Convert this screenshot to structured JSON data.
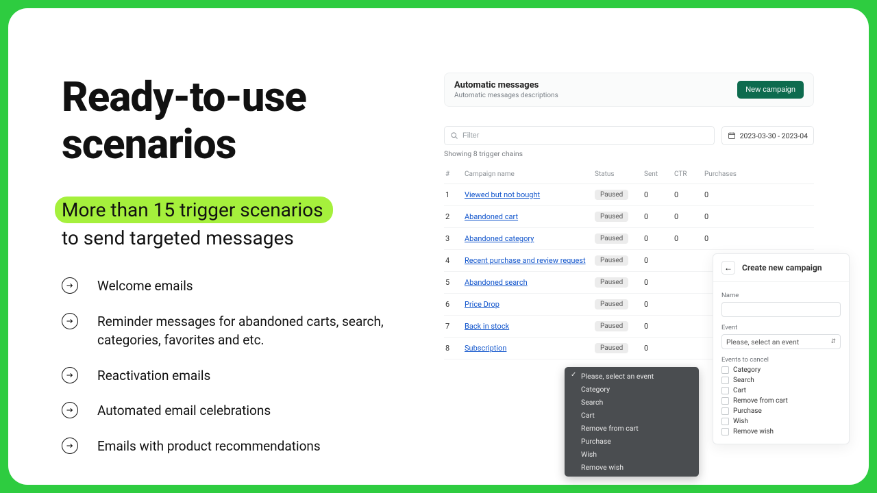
{
  "left": {
    "headline_l1": "Ready-to-use",
    "headline_l2": "scenarios",
    "sub_hl": "More than 15 trigger scenarios",
    "sub_rest": "to send targeted messages",
    "features": [
      "Welcome emails",
      "Reminder messages for abandoned carts, search, categories, favorites and etc.",
      "Reactivation emails",
      "Automated email celebrations",
      "Emails with product recommendations"
    ]
  },
  "app": {
    "title": "Automatic messages",
    "subtitle": "Automatic messages descriptions",
    "new_campaign": "New campaign",
    "filter_placeholder": "Filter",
    "date_range": "2023-03-30 - 2023-04",
    "showing": "Showing 8 trigger chains",
    "columns": {
      "n": "#",
      "name": "Campaign name",
      "status": "Status",
      "sent": "Sent",
      "ctr": "CTR",
      "purch": "Purchases"
    },
    "rows": [
      {
        "n": "1",
        "name": "Viewed but not bought",
        "status": "Paused",
        "sent": "0",
        "ctr": "0",
        "purch": "0"
      },
      {
        "n": "2",
        "name": "Abandoned cart",
        "status": "Paused",
        "sent": "0",
        "ctr": "0",
        "purch": "0"
      },
      {
        "n": "3",
        "name": "Abandoned category",
        "status": "Paused",
        "sent": "0",
        "ctr": "0",
        "purch": "0"
      },
      {
        "n": "4",
        "name": "Recent purchase and review request",
        "status": "Paused",
        "sent": "0",
        "ctr": "",
        "purch": ""
      },
      {
        "n": "5",
        "name": "Abandoned search",
        "status": "Paused",
        "sent": "0",
        "ctr": "",
        "purch": ""
      },
      {
        "n": "6",
        "name": "Price Drop",
        "status": "Paused",
        "sent": "0",
        "ctr": "",
        "purch": ""
      },
      {
        "n": "7",
        "name": "Back in stock",
        "status": "Paused",
        "sent": "0",
        "ctr": "",
        "purch": ""
      },
      {
        "n": "8",
        "name": "Subscription",
        "status": "Paused",
        "sent": "0",
        "ctr": "",
        "purch": ""
      }
    ]
  },
  "dropdown": {
    "items": [
      "Please, select an event",
      "Category",
      "Search",
      "Cart",
      "Remove from cart",
      "Purchase",
      "Wish",
      "Remove wish"
    ]
  },
  "create": {
    "title": "Create new campaign",
    "name_label": "Name",
    "event_label": "Event",
    "event_placeholder": "Please, select an event",
    "cancel_label": "Events to cancel",
    "cancel_items": [
      "Category",
      "Search",
      "Cart",
      "Remove from cart",
      "Purchase",
      "Wish",
      "Remove wish"
    ]
  }
}
